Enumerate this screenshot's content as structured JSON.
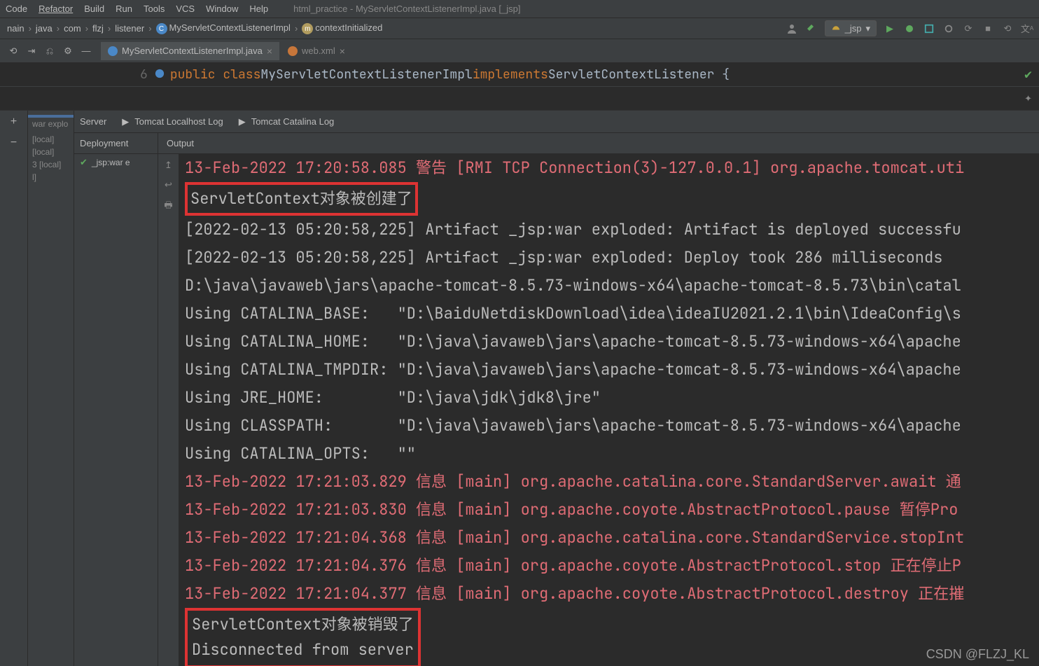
{
  "menubar": [
    "Code",
    "Refactor",
    "Build",
    "Run",
    "Tools",
    "VCS",
    "Window",
    "Help"
  ],
  "titlebar": "html_practice - MyServletContextListenerImpl.java [_jsp]",
  "breadcrumb": {
    "items": [
      "nain",
      "java",
      "com",
      "flzj",
      "listener",
      "MyServletContextListenerImpl",
      "contextInitialized"
    ],
    "class_index": 5,
    "method_index": 6
  },
  "run_config": "_jsp",
  "editor_tabs": [
    {
      "name": "MyServletContextListenerImpl.java",
      "active": true,
      "icon": "blue"
    },
    {
      "name": "web.xml",
      "active": false,
      "icon": "orange"
    }
  ],
  "code_snippet": {
    "prefix": "public class ",
    "classname": "MyServletContextListenerImpl ",
    "impl": "implements ",
    "iface": "ServletContextListener {"
  },
  "left_add": "+",
  "left_tree": [
    {
      "label": "",
      "hl": true
    },
    {
      "label": "war explo",
      "hl": false
    },
    {
      "label": "",
      "hl": false
    },
    {
      "label": "[local]",
      "hl": false
    },
    {
      "label": "[local]",
      "hl": false
    },
    {
      "label": "3 [local]",
      "hl": false
    },
    {
      "label": "l]",
      "hl": false
    }
  ],
  "run_tabs": [
    "Server",
    "Tomcat Localhost Log",
    "Tomcat Catalina Log"
  ],
  "sub_row": {
    "deployment": "Deployment",
    "output": "Output"
  },
  "deploy_item": "_jsp:war e",
  "console_side_icons": [
    "arrow-up-icon",
    "text-wrap-icon",
    "print-icon"
  ],
  "console_lines": [
    {
      "type": "pink",
      "text": "13-Feb-2022 17:20:58.085 警告 [RMI TCP Connection(3)-127.0.0.1] org.apache.tomcat.uti"
    },
    {
      "type": "boxed-gray",
      "text": "ServletContext对象被创建了"
    },
    {
      "type": "gray",
      "text": "[2022-02-13 05:20:58,225] Artifact _jsp:war exploded: Artifact is deployed successfu"
    },
    {
      "type": "gray",
      "text": "[2022-02-13 05:20:58,225] Artifact _jsp:war exploded: Deploy took 286 milliseconds"
    },
    {
      "type": "gray",
      "text": "D:\\java\\javaweb\\jars\\apache-tomcat-8.5.73-windows-x64\\apache-tomcat-8.5.73\\bin\\catal"
    },
    {
      "type": "gray",
      "text": "Using CATALINA_BASE:   \"D:\\BaiduNetdiskDownload\\idea\\ideaIU2021.2.1\\bin\\IdeaConfig\\s"
    },
    {
      "type": "gray",
      "text": "Using CATALINA_HOME:   \"D:\\java\\javaweb\\jars\\apache-tomcat-8.5.73-windows-x64\\apache"
    },
    {
      "type": "gray",
      "text": "Using CATALINA_TMPDIR: \"D:\\java\\javaweb\\jars\\apache-tomcat-8.5.73-windows-x64\\apache"
    },
    {
      "type": "gray",
      "text": "Using JRE_HOME:        \"D:\\java\\jdk\\jdk8\\jre\""
    },
    {
      "type": "gray",
      "text": "Using CLASSPATH:       \"D:\\java\\javaweb\\jars\\apache-tomcat-8.5.73-windows-x64\\apache"
    },
    {
      "type": "gray",
      "text": "Using CATALINA_OPTS:   \"\""
    },
    {
      "type": "pink",
      "text": "13-Feb-2022 17:21:03.829 信息 [main] org.apache.catalina.core.StandardServer.await 通"
    },
    {
      "type": "pink",
      "text": "13-Feb-2022 17:21:03.830 信息 [main] org.apache.coyote.AbstractProtocol.pause 暂停Pro"
    },
    {
      "type": "pink",
      "text": "13-Feb-2022 17:21:04.368 信息 [main] org.apache.catalina.core.StandardService.stopInt"
    },
    {
      "type": "pink",
      "text": "13-Feb-2022 17:21:04.376 信息 [main] org.apache.coyote.AbstractProtocol.stop 正在停止P"
    },
    {
      "type": "pink",
      "text": "13-Feb-2022 17:21:04.377 信息 [main] org.apache.coyote.AbstractProtocol.destroy 正在摧"
    }
  ],
  "boxed_block": [
    "ServletContext对象被销毁了",
    "Disconnected from server"
  ],
  "watermark": "CSDN @FLZJ_KL"
}
